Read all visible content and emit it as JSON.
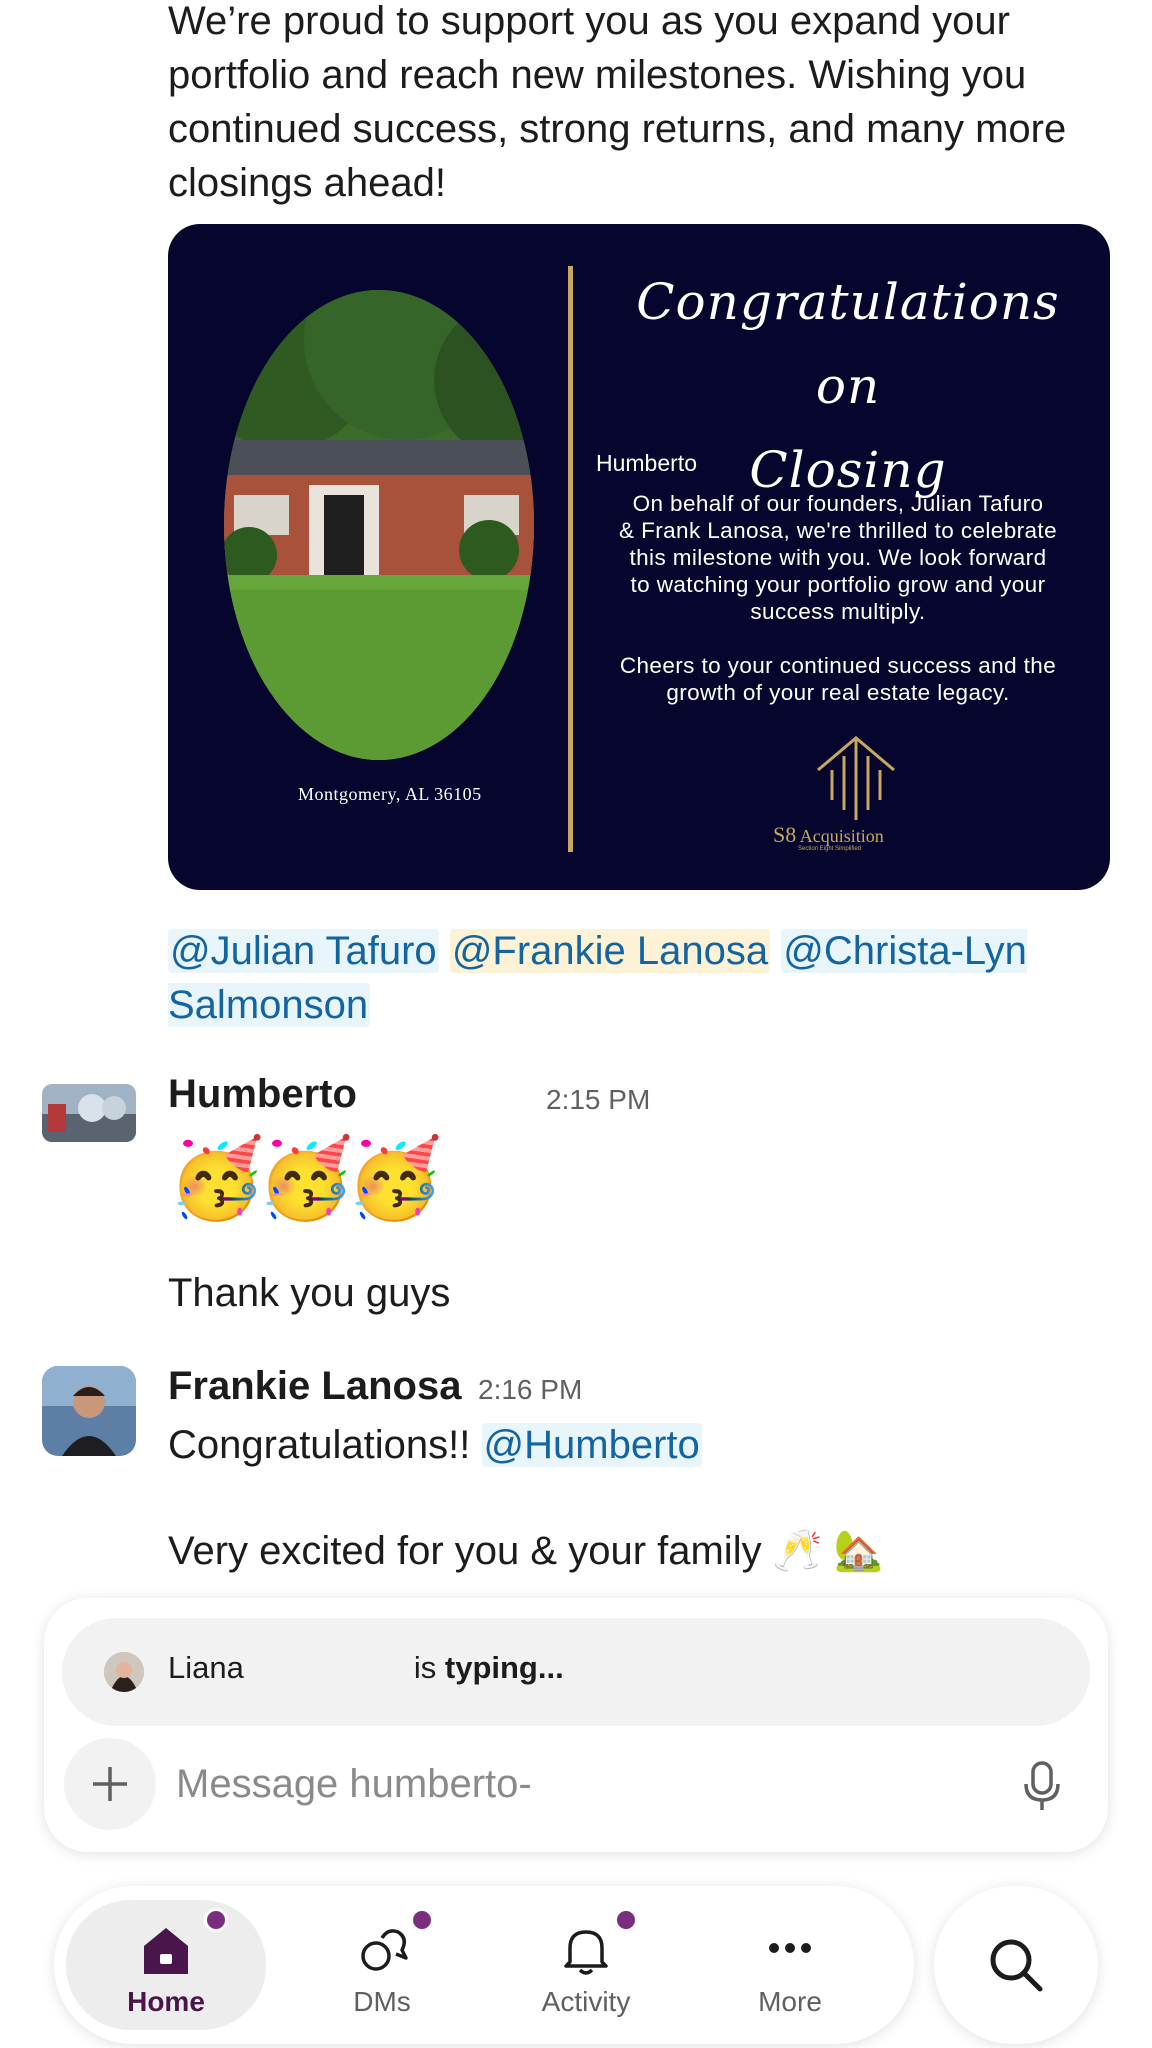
{
  "intro_message": {
    "text": "We’re proud to support you as you expand your portfolio and reach new milestones. Wishing you continued success, strong returns, and many more closings ahead!"
  },
  "card": {
    "title_line1": "Congratulations on",
    "title_line2": "Closing",
    "recipient": "Humberto",
    "body": "On behalf of our founders, Julian Tafuro\n& Frank Lanosa, we're thrilled to celebrate\nthis milestone with you. We look forward\nto watching your portfolio grow and your\nsuccess multiply.\n\nCheers to your continued success and the\ngrowth of your real estate legacy.",
    "location": "Montgomery, AL 36105",
    "logo_mark": "S8",
    "logo_name": "Acquisition",
    "logo_tagline": "Section Eight Simplified"
  },
  "mentions": [
    "@Julian Tafuro",
    "@Frankie Lanosa",
    "@Christa-Lyn Salmonson"
  ],
  "messages": [
    {
      "sender": "Humberto",
      "time": "2:15 PM",
      "emoji": "🥳🥳🥳",
      "text": "Thank you guys"
    },
    {
      "sender": "Frankie Lanosa",
      "time": "2:16 PM",
      "text_prefix": "Congratulations!! ",
      "mention": "@Humberto",
      "text2": "Very excited for you & your family 🥂 🏡"
    }
  ],
  "composer": {
    "typing_name": "Liana",
    "typing_suffix": "is",
    "typing_bold": "typing...",
    "placeholder": "Message humberto-"
  },
  "tabs": [
    {
      "label": "Home",
      "icon": "home-icon",
      "active": true,
      "badge": true
    },
    {
      "label": "DMs",
      "icon": "dms-icon",
      "active": false,
      "badge": true
    },
    {
      "label": "Activity",
      "icon": "bell-icon",
      "active": false,
      "badge": true
    },
    {
      "label": "More",
      "icon": "more-icon",
      "active": false,
      "badge": false
    }
  ],
  "colors": {
    "brand_purple": "#4a154b",
    "badge": "#7c2e7e",
    "mention_text": "#1264a3",
    "card_background": "#06052e",
    "card_gold": "#c9a75e"
  }
}
